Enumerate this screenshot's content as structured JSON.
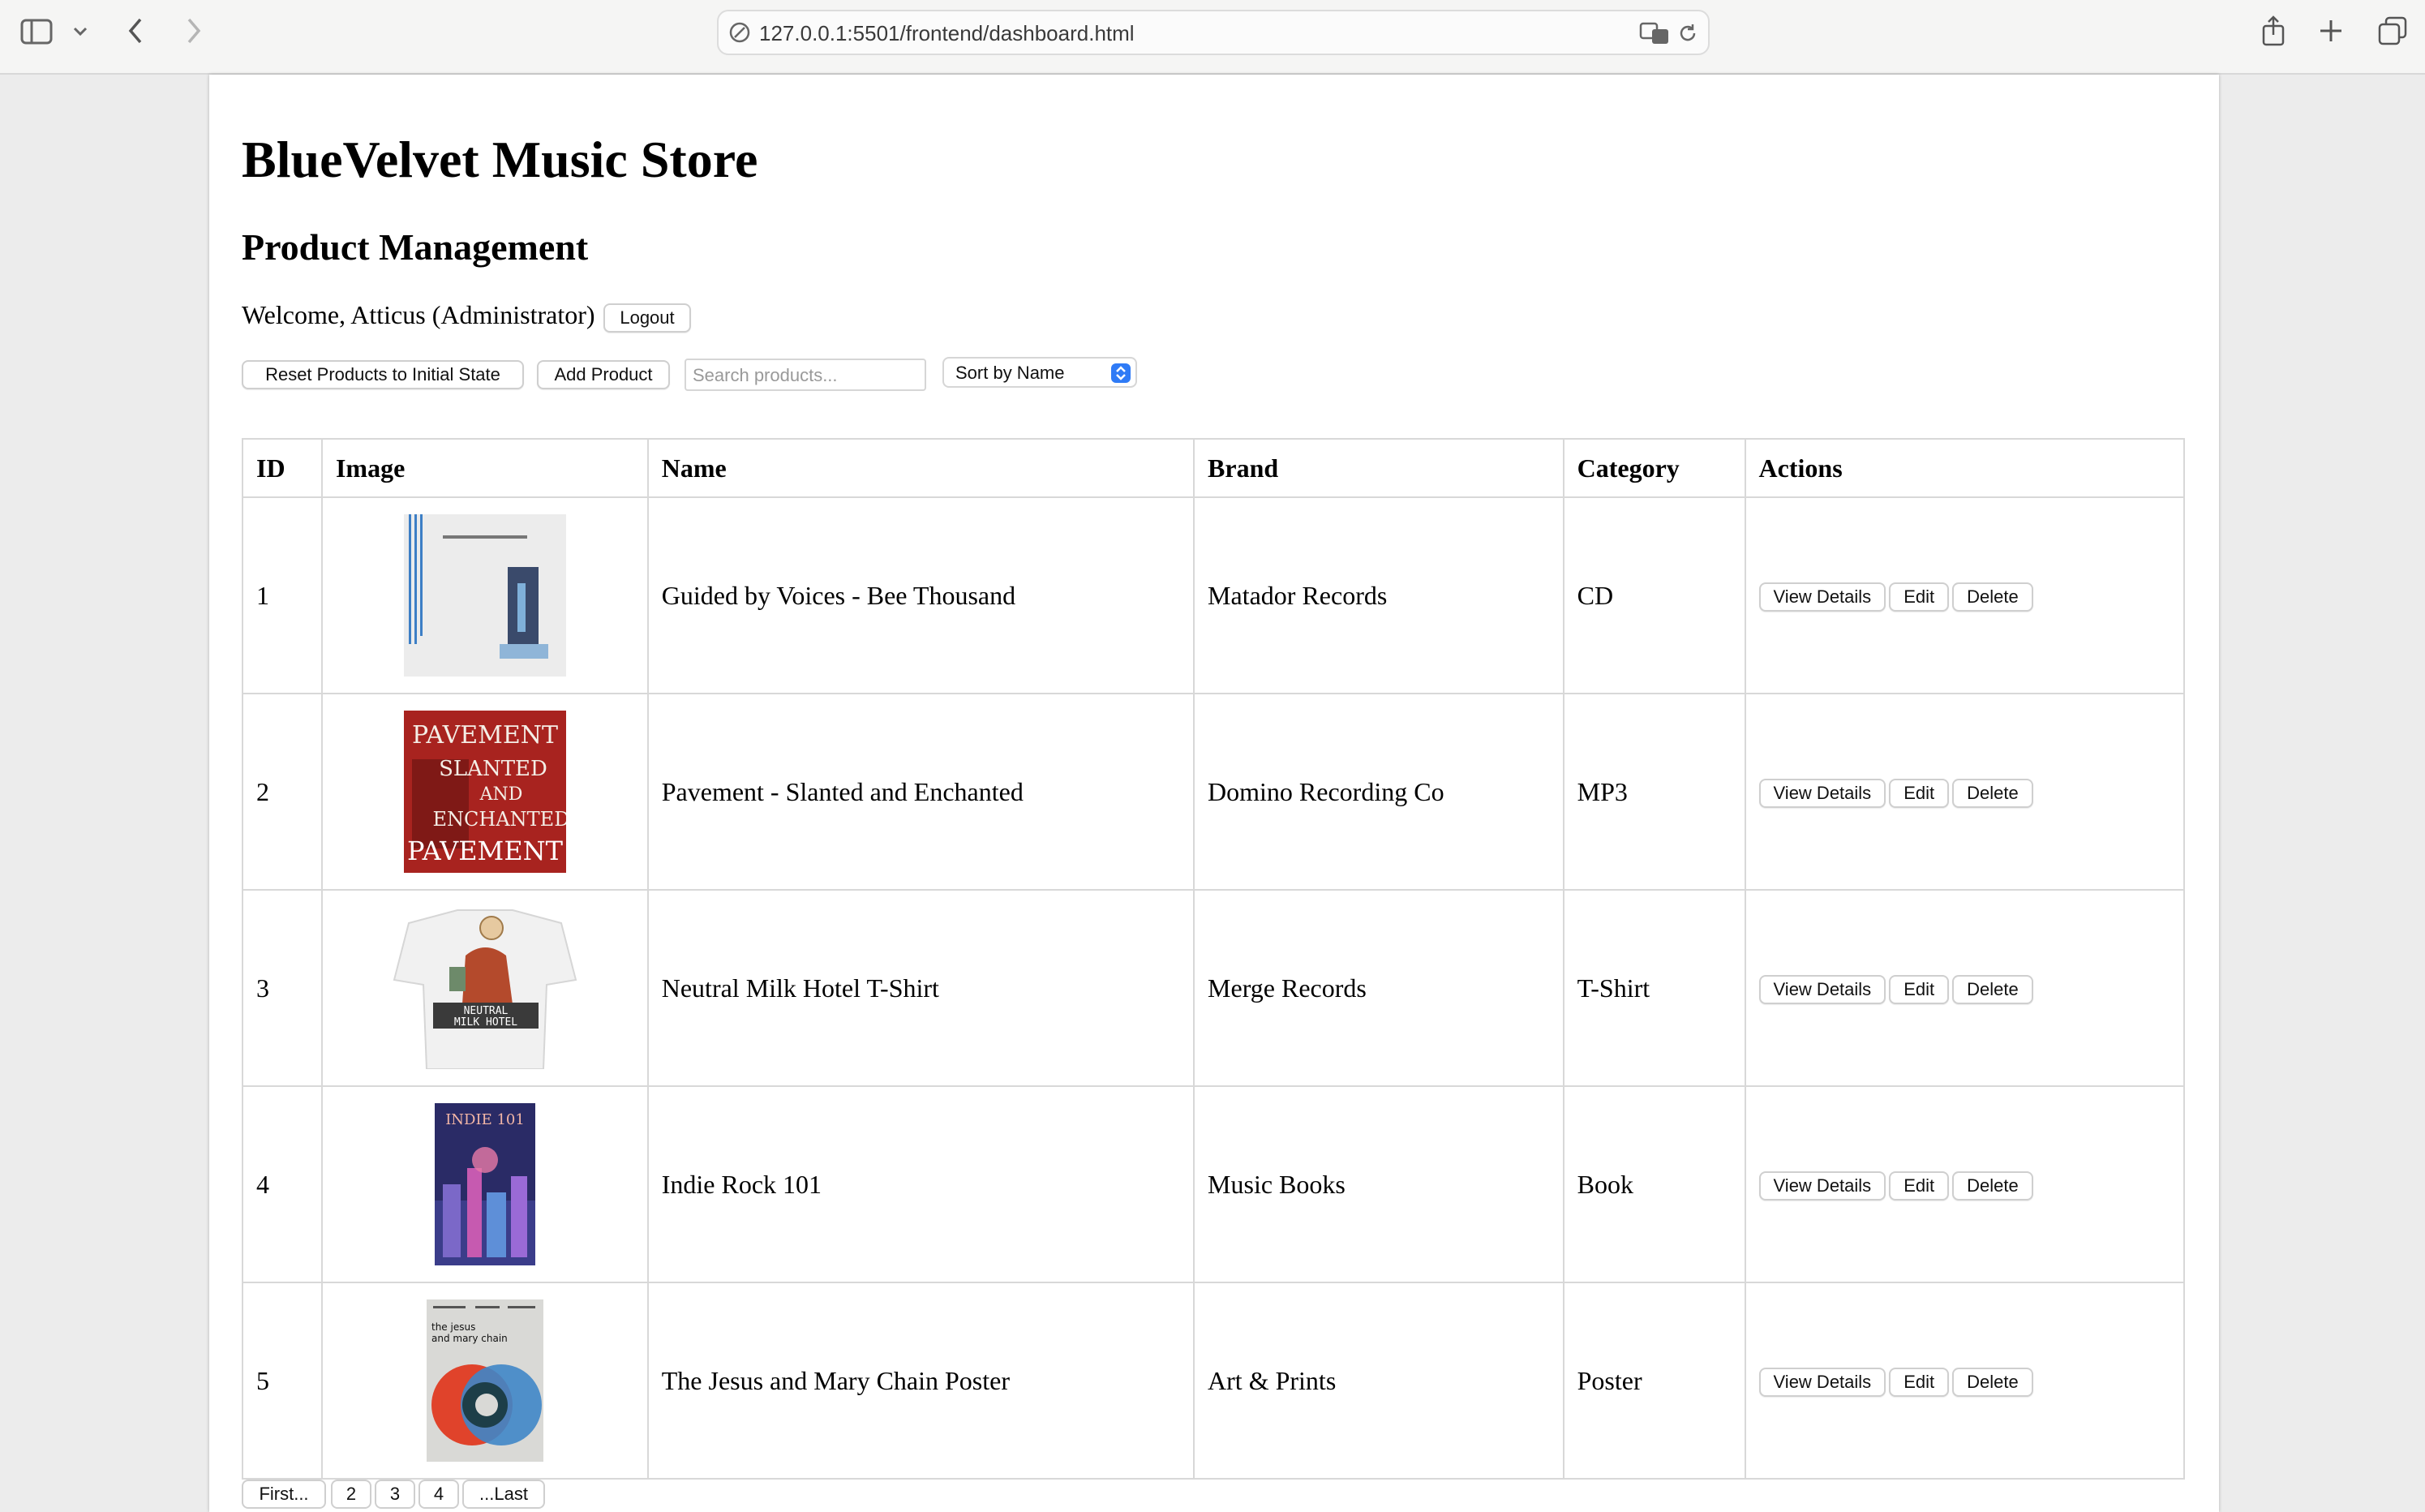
{
  "browser": {
    "url": "127.0.0.1:5501/frontend/dashboard.html"
  },
  "page": {
    "store_title": "BlueVelvet Music Store",
    "section_title": "Product Management",
    "welcome_text": "Welcome, Atticus (Administrator)",
    "logout_label": "Logout"
  },
  "toolbar": {
    "reset_label": "Reset Products to Initial State",
    "add_label": "Add Product",
    "search_placeholder": "Search products...",
    "sort_selected": "Sort by Name"
  },
  "table": {
    "headers": [
      "ID",
      "Image",
      "Name",
      "Brand",
      "Category",
      "Actions"
    ],
    "rows": [
      {
        "id": "1",
        "name": "Guided by Voices - Bee Thousand",
        "brand": "Matador Records",
        "category": "CD"
      },
      {
        "id": "2",
        "name": "Pavement - Slanted and Enchanted",
        "brand": "Domino Recording Co",
        "category": "MP3"
      },
      {
        "id": "3",
        "name": "Neutral Milk Hotel T-Shirt",
        "brand": "Merge Records",
        "category": "T-Shirt"
      },
      {
        "id": "4",
        "name": "Indie Rock 101",
        "brand": "Music Books",
        "category": "Book"
      },
      {
        "id": "5",
        "name": "The Jesus and Mary Chain Poster",
        "brand": "Art & Prints",
        "category": "Poster"
      }
    ],
    "actions": {
      "view": "View Details",
      "edit": "Edit",
      "delete": "Delete"
    }
  },
  "thumbnails": {
    "pavement_text": [
      "PAVEMENT",
      "SLANTED",
      "AND",
      "ENCHANTED"
    ],
    "shirt_text": [
      "NEUTRAL",
      "MILK HOTEL"
    ],
    "book_text": "INDIE 101",
    "poster_text": [
      "the jesus",
      "and mary chain"
    ]
  },
  "pagination": [
    "First...",
    "2",
    "3",
    "4",
    "...Last"
  ],
  "colors": {
    "select_accent": "#2f7bf6",
    "pavement_red": "#a8231f",
    "poster_red": "#e0432b",
    "poster_blue": "#3f86c8"
  }
}
